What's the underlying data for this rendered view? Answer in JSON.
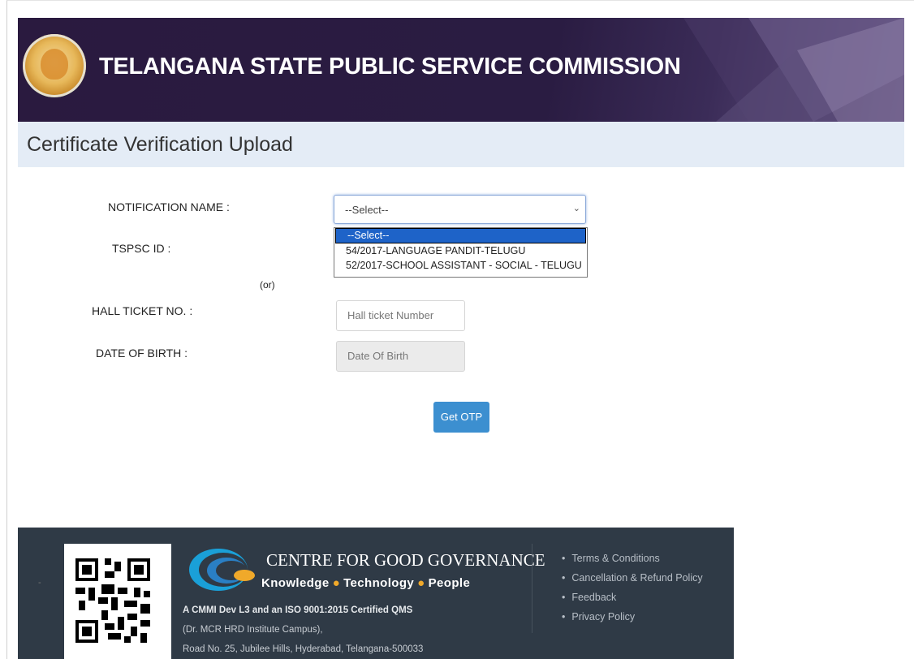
{
  "header": {
    "title": "TELANGANA STATE PUBLIC SERVICE COMMISSION"
  },
  "page": {
    "title": "Certificate Verification Upload"
  },
  "form": {
    "notification_label": "NOTIFICATION NAME :",
    "tspsc_id_label": "TSPSC ID :",
    "or_text": "(or)",
    "hall_ticket_label": "HALL TICKET NO. :",
    "dob_label": "DATE OF BIRTH :",
    "notification_select": {
      "value": "--Select--",
      "options": [
        "--Select--",
        "54/2017-LANGUAGE PANDIT-TELUGU",
        "52/2017-SCHOOL ASSISTANT - SOCIAL - TELUGU"
      ]
    },
    "hall_ticket_placeholder": "Hall ticket Number",
    "dob_placeholder": "Date Of Birth",
    "get_otp_label": "Get OTP"
  },
  "footer": {
    "org_name": "CENTRE FOR GOOD GOVERNANCE",
    "tagline": [
      "Knowledge",
      "Technology",
      "People"
    ],
    "cert_line": "A CMMI Dev L3 and an ISO 9001:2015 Certified QMS",
    "address_line1": "(Dr. MCR HRD Institute Campus),",
    "address_line2": "Road No. 25, Jubilee Hills, Hyderabad, Telangana-500033",
    "links": [
      "Terms & Conditions",
      "Cancellation & Refund Policy",
      "Feedback",
      "Privacy Policy"
    ]
  },
  "colors": {
    "banner": "#2a1a3f",
    "subheader": "#e4ecf6",
    "button": "#3c8fd0",
    "footer": "#2f3a46",
    "accent_dot": "#f0a92a"
  }
}
